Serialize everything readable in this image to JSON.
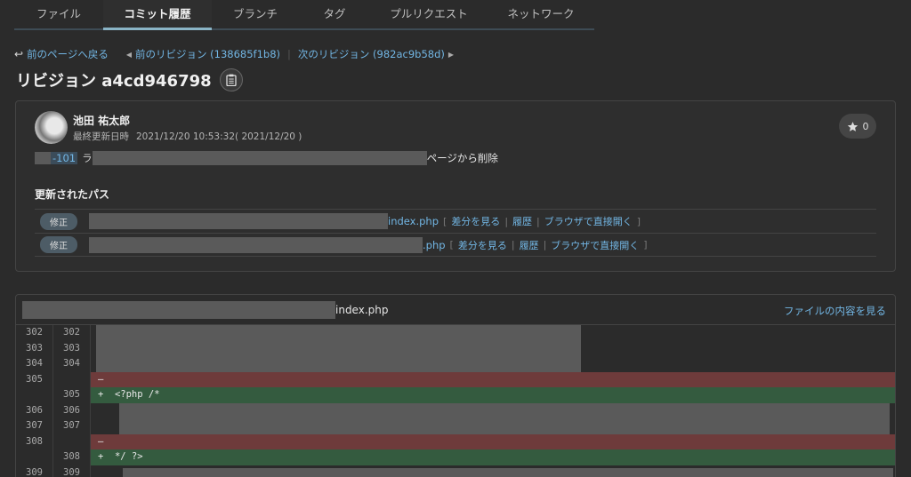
{
  "tabs": [
    "ファイル",
    "コミット履歴",
    "ブランチ",
    "タグ",
    "プルリクエスト",
    "ネットワーク"
  ],
  "nav": {
    "back": "前のページへ戻る",
    "prev_rev": "前のリビジョン (138685f1b8)",
    "next_rev": "次のリビジョン (982ac9b58d)"
  },
  "title": "リビジョン a4cd946798",
  "commit": {
    "author": "池田 祐太郎",
    "updated_label": "最終更新日時",
    "updated_value": "2021/12/20 10:53:32( 2021/12/20 )",
    "star_count": "0",
    "issue_ref": "-101",
    "message_tail": "ページから削除"
  },
  "paths": {
    "heading": "更新されたパス",
    "items": [
      {
        "badge": "修正",
        "file": "index.php",
        "diff": "差分を見る",
        "history": "履歴",
        "browser": "ブラウザで直接開く"
      },
      {
        "badge": "修正",
        "file": ".php",
        "diff": "差分を見る",
        "history": "履歴",
        "browser": "ブラウザで直接開く"
      }
    ]
  },
  "diff": {
    "filename": "index.php",
    "view_label": "ファイルの内容を見る",
    "lines": [
      {
        "old": "302",
        "new": "302",
        "type": "ctx",
        "text": ""
      },
      {
        "old": "303",
        "new": "303",
        "type": "ctx",
        "text": ""
      },
      {
        "old": "304",
        "new": "304",
        "type": "ctx",
        "text": ""
      },
      {
        "old": "305",
        "new": "",
        "type": "del",
        "text": "—"
      },
      {
        "old": "",
        "new": "305",
        "type": "add",
        "text": "+  <?php /*"
      },
      {
        "old": "306",
        "new": "306",
        "type": "ctx",
        "text": ""
      },
      {
        "old": "307",
        "new": "307",
        "type": "ctx",
        "text": ""
      },
      {
        "old": "308",
        "new": "",
        "type": "del",
        "text": "—"
      },
      {
        "old": "",
        "new": "308",
        "type": "add",
        "text": "+  */ ?>"
      },
      {
        "old": "309",
        "new": "309",
        "type": "ctx",
        "text": ""
      }
    ]
  },
  "colors": {
    "link": "#72b6e4",
    "deleted": "#6e3b3b",
    "added": "#345b3f",
    "tab_underline": "#8ab4c6"
  }
}
